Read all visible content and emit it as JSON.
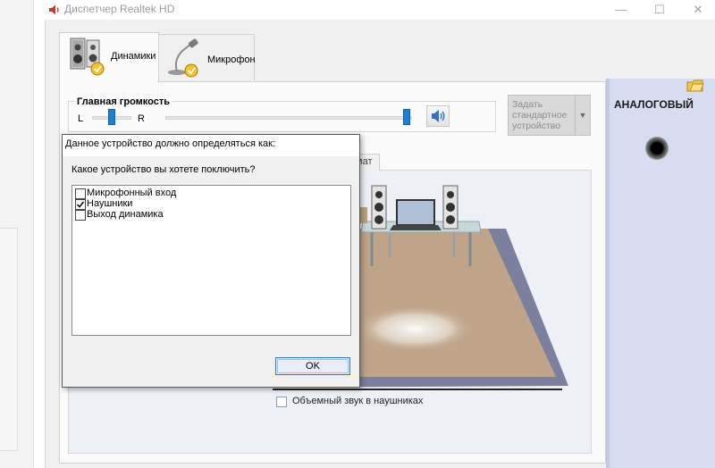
{
  "window": {
    "title": "Диспетчер Realtek HD",
    "minimize_glyph": "—",
    "maximize_glyph": "☐",
    "close_glyph": "✕"
  },
  "tabs": [
    {
      "label": "Динамики",
      "icon": "speakers-icon",
      "selected": true
    },
    {
      "label": "Микрофон",
      "icon": "microphone-icon",
      "selected": false
    }
  ],
  "volume": {
    "title": "Главная громкость",
    "left_label": "L",
    "right_label": "R",
    "balance": 0.5,
    "level": 1.0,
    "accent_color": "#1f7fd8"
  },
  "default_device": {
    "label": "Задать стандартное устройство",
    "arrow": "▼"
  },
  "analog": {
    "label": "АНАЛОГОВЫЙ",
    "jack_icon": "audio-jack-icon",
    "panel_color": "#d8dcf0"
  },
  "hidden_tab_fragment": "мат",
  "surround": {
    "label": "Объемный звук в наушниках",
    "checked": false
  },
  "dialog": {
    "title": "Данное устройство должно определяться как:",
    "question": "Какое устройство вы хотете поключить?",
    "options": [
      {
        "label": "Микрофонный вход",
        "checked": false
      },
      {
        "label": "Наушники",
        "checked": true
      },
      {
        "label": "Выход динамика",
        "checked": false
      }
    ],
    "ok_label": "OK"
  }
}
